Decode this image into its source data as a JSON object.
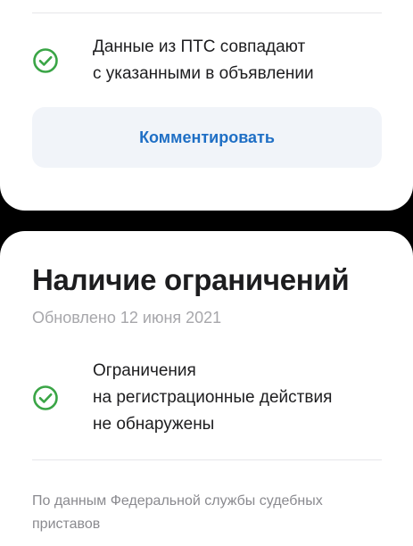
{
  "pts_check": {
    "icon": "check-circle-icon",
    "lines": [
      "Данные из ПТС совпадают",
      "с указанными в объявлении"
    ],
    "comment_button_label": "Комментировать"
  },
  "restrictions": {
    "title": "Наличие ограничений",
    "updated": "Обновлено 12 июня 2021",
    "check": {
      "icon": "check-circle-icon",
      "lines": [
        "Ограничения",
        "на регистрационные действия",
        "не обнаружены"
      ]
    },
    "source_lines": [
      "По данным Федеральной службы судебных",
      "приставов"
    ]
  },
  "colors": {
    "check_green": "#3aa546",
    "link_blue": "#1f6fc5",
    "button_bg": "#f1f4f9",
    "secondary_text": "#a7a7ab",
    "background": "#000000"
  }
}
